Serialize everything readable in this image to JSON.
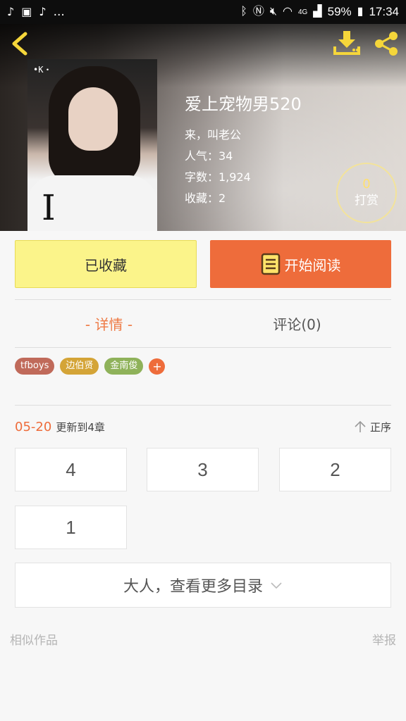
{
  "status_bar": {
    "left_icons": [
      "tiktok-icon",
      "baidu-icon",
      "tiktok-icon"
    ],
    "more": "...",
    "battery": "59%",
    "time": "17:34",
    "network": "4G"
  },
  "book": {
    "title": "爱上宠物男520",
    "subtitle": "来，叫老公",
    "popularity": "人气：34",
    "word_count": "字数：1,924",
    "favorites": "收藏：2",
    "cover_mark": "•K・"
  },
  "reward": {
    "count": "0",
    "label": "打赏"
  },
  "actions": {
    "favorited_label": "已收藏",
    "start_reading_label": "开始阅读"
  },
  "tabs": {
    "details": "- 详情 -",
    "comments": "评论(0)"
  },
  "tags": [
    {
      "label": "tfboys",
      "color": "#c06a5a"
    },
    {
      "label": "边伯贤",
      "color": "#d4a437"
    },
    {
      "label": "金南俊",
      "color": "#8fb25a"
    }
  ],
  "tag_add_label": "+",
  "update": {
    "date": "05-20",
    "text": "更新到4章",
    "order_label": "正序"
  },
  "chapters": [
    "4",
    "3",
    "2",
    "1"
  ],
  "more_catalog_label": "大人，查看更多目录",
  "footer": {
    "similar": "相似作品",
    "report": "举报"
  },
  "colors": {
    "accent": "#ee6c3b",
    "favorite_bg": "#fbf48a",
    "reward_border": "#f3e39a"
  }
}
